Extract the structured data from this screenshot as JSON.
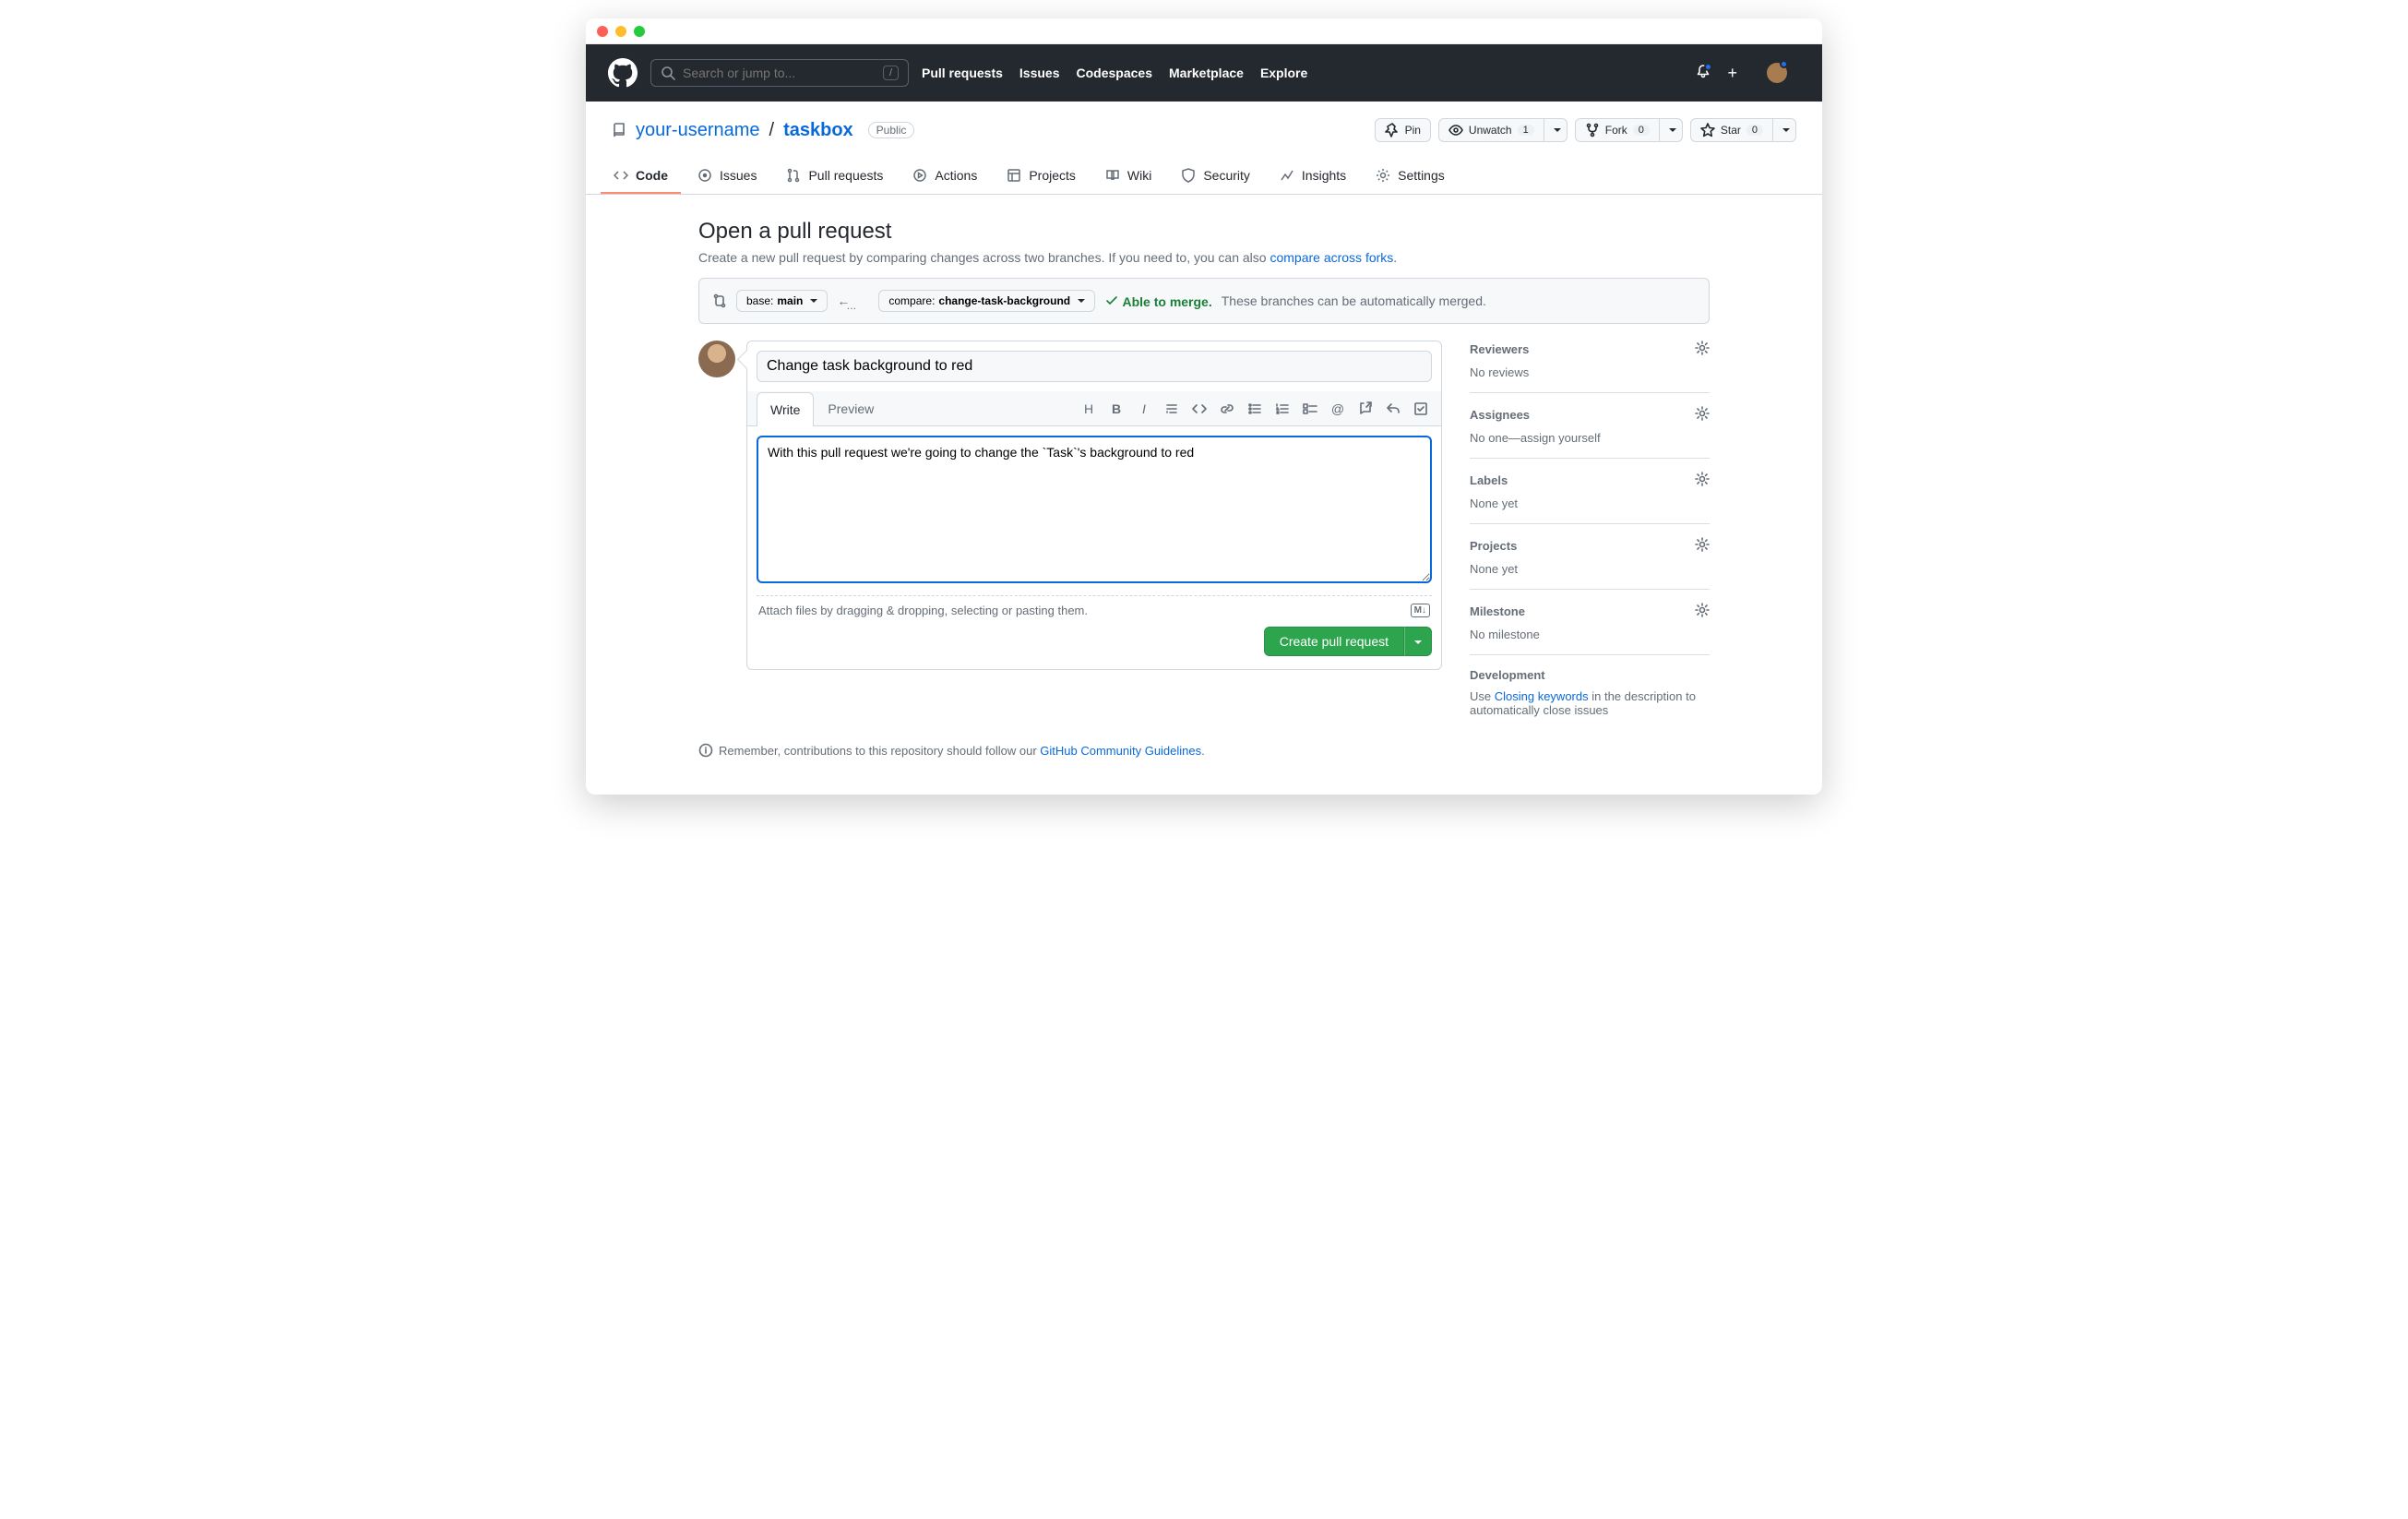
{
  "search": {
    "placeholder": "Search or jump to...",
    "slash": "/"
  },
  "topnav": {
    "pulls": "Pull requests",
    "issues": "Issues",
    "codespaces": "Codespaces",
    "marketplace": "Marketplace",
    "explore": "Explore"
  },
  "repo": {
    "owner": "your-username",
    "sep": "/",
    "name": "taskbox",
    "visibility": "Public"
  },
  "actions": {
    "pin": "Pin",
    "unwatch": "Unwatch",
    "unwatch_count": "1",
    "fork": "Fork",
    "fork_count": "0",
    "star": "Star",
    "star_count": "0"
  },
  "tabs": {
    "code": "Code",
    "issues": "Issues",
    "pulls": "Pull requests",
    "actions": "Actions",
    "projects": "Projects",
    "wiki": "Wiki",
    "security": "Security",
    "insights": "Insights",
    "settings": "Settings"
  },
  "page": {
    "title": "Open a pull request",
    "subtitle_a": "Create a new pull request by comparing changes across two branches. If you need to, you can also ",
    "subtitle_link": "compare across forks",
    "subtitle_b": "."
  },
  "branch": {
    "base_label": "base: ",
    "base_value": "main",
    "compare_label": "compare: ",
    "compare_value": "change-task-background",
    "able": "Able to merge.",
    "able_desc": "These branches can be automatically merged."
  },
  "composer": {
    "title_value": "Change task background to red",
    "write": "Write",
    "preview": "Preview",
    "body_value": "With this pull request we're going to change the `Task`'s background to red",
    "attach": "Attach files by dragging & dropping, selecting or pasting them.",
    "md": "M↓",
    "submit": "Create pull request"
  },
  "note": {
    "a": "Remember, contributions to this repository should follow our ",
    "link": "GitHub Community Guidelines",
    "b": "."
  },
  "sidebar": {
    "reviewers": {
      "title": "Reviewers",
      "value": "No reviews"
    },
    "assignees": {
      "title": "Assignees",
      "value_a": "No one—",
      "value_link": "assign yourself"
    },
    "labels": {
      "title": "Labels",
      "value": "None yet"
    },
    "projects": {
      "title": "Projects",
      "value": "None yet"
    },
    "milestone": {
      "title": "Milestone",
      "value": "No milestone"
    },
    "development": {
      "title": "Development",
      "value_a": "Use ",
      "value_link": "Closing keywords",
      "value_b": " in the description to automatically close issues"
    }
  }
}
